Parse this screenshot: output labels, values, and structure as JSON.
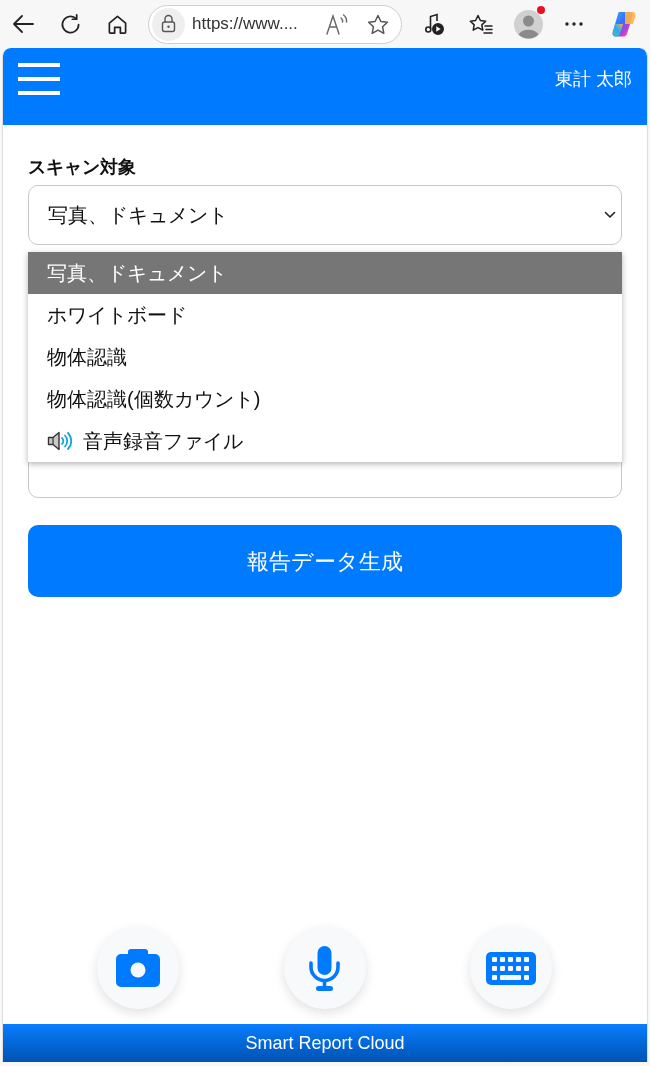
{
  "browser": {
    "url": "https://www...."
  },
  "header": {
    "user_name": "東計 太郎"
  },
  "scan_target": {
    "label": "スキャン対象",
    "value": "写真、ドキュメント",
    "expanded": true,
    "options": [
      {
        "label": "写真、ドキュメント",
        "selected": true,
        "kind": "text"
      },
      {
        "label": "ホワイトボード",
        "selected": false,
        "kind": "text"
      },
      {
        "label": "物体認識",
        "selected": false,
        "kind": "text"
      },
      {
        "label": "物体認識(個数カウント)",
        "selected": false,
        "kind": "text"
      },
      {
        "label": "音声録音ファイル",
        "selected": false,
        "kind": "audio"
      }
    ]
  },
  "generate_button": {
    "label": "報告データ生成"
  },
  "action_buttons": [
    {
      "kind": "camera"
    },
    {
      "kind": "microphone"
    },
    {
      "kind": "keyboard"
    }
  ],
  "footer": {
    "text": "Smart Report Cloud"
  }
}
